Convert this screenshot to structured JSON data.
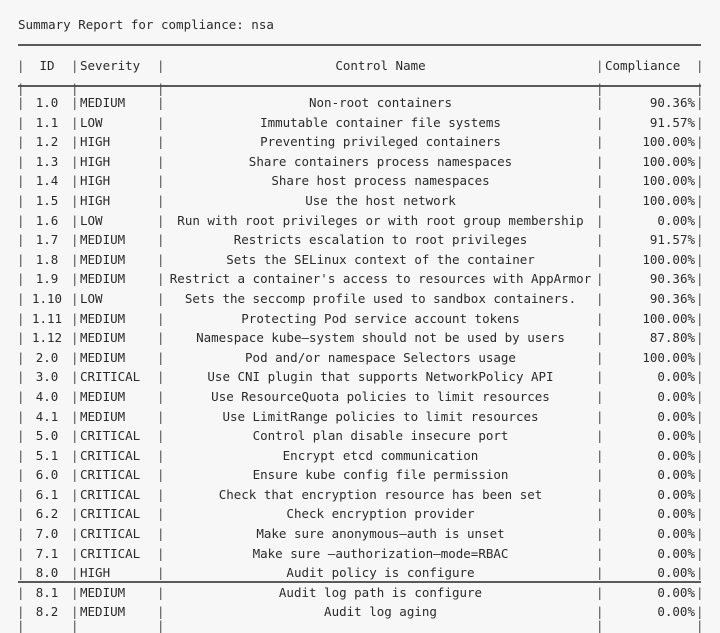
{
  "report": {
    "title": "Summary Report for compliance: nsa"
  },
  "table": {
    "columns": [
      {
        "key": "id",
        "label": "ID"
      },
      {
        "key": "severity",
        "label": "Severity"
      },
      {
        "key": "name",
        "label": "Control Name"
      },
      {
        "key": "compliance",
        "label": "Compliance"
      }
    ],
    "rows": [
      {
        "id": "1.0",
        "severity": "MEDIUM",
        "name": "Non-root containers",
        "compliance": "90.36%"
      },
      {
        "id": "1.1",
        "severity": "LOW",
        "name": "Immutable container file systems",
        "compliance": "91.57%"
      },
      {
        "id": "1.2",
        "severity": "HIGH",
        "name": "Preventing privileged containers",
        "compliance": "100.00%"
      },
      {
        "id": "1.3",
        "severity": "HIGH",
        "name": "Share containers process namespaces",
        "compliance": "100.00%"
      },
      {
        "id": "1.4",
        "severity": "HIGH",
        "name": "Share host process namespaces",
        "compliance": "100.00%"
      },
      {
        "id": "1.5",
        "severity": "HIGH",
        "name": "Use the host network",
        "compliance": "100.00%"
      },
      {
        "id": "1.6",
        "severity": "LOW",
        "name": "Run with root privileges or with root group membership",
        "compliance": "0.00%"
      },
      {
        "id": "1.7",
        "severity": "MEDIUM",
        "name": "Restricts escalation to root privileges",
        "compliance": "91.57%"
      },
      {
        "id": "1.8",
        "severity": "MEDIUM",
        "name": "Sets the SELinux context of the container",
        "compliance": "100.00%"
      },
      {
        "id": "1.9",
        "severity": "MEDIUM",
        "name": "Restrict a container's access to resources with AppArmor",
        "compliance": "90.36%"
      },
      {
        "id": "1.10",
        "severity": "LOW",
        "name": "Sets the seccomp profile used to sandbox containers.",
        "compliance": "90.36%"
      },
      {
        "id": "1.11",
        "severity": "MEDIUM",
        "name": "Protecting Pod service account tokens",
        "compliance": "100.00%"
      },
      {
        "id": "1.12",
        "severity": "MEDIUM",
        "name": "Namespace kube–system should not be used by users",
        "compliance": "87.80%"
      },
      {
        "id": "2.0",
        "severity": "MEDIUM",
        "name": "Pod and/or namespace Selectors usage",
        "compliance": "100.00%"
      },
      {
        "id": "3.0",
        "severity": "CRITICAL",
        "name": "Use CNI plugin that supports NetworkPolicy API",
        "compliance": "0.00%"
      },
      {
        "id": "4.0",
        "severity": "MEDIUM",
        "name": "Use ResourceQuota policies to limit resources",
        "compliance": "0.00%"
      },
      {
        "id": "4.1",
        "severity": "MEDIUM",
        "name": "Use LimitRange policies to limit resources",
        "compliance": "0.00%"
      },
      {
        "id": "5.0",
        "severity": "CRITICAL",
        "name": "Control plan disable insecure port",
        "compliance": "0.00%"
      },
      {
        "id": "5.1",
        "severity": "CRITICAL",
        "name": "Encrypt etcd communication",
        "compliance": "0.00%"
      },
      {
        "id": "6.0",
        "severity": "CRITICAL",
        "name": "Ensure kube config file permission",
        "compliance": "0.00%"
      },
      {
        "id": "6.1",
        "severity": "CRITICAL",
        "name": "Check that encryption resource has been set",
        "compliance": "0.00%"
      },
      {
        "id": "6.2",
        "severity": "CRITICAL",
        "name": "Check encryption provider",
        "compliance": "0.00%"
      },
      {
        "id": "7.0",
        "severity": "CRITICAL",
        "name": "Make sure anonymous–auth is unset",
        "compliance": "0.00%"
      },
      {
        "id": "7.1",
        "severity": "CRITICAL",
        "name": "Make sure –authorization–mode=RBAC",
        "compliance": "0.00%"
      },
      {
        "id": "8.0",
        "severity": "HIGH",
        "name": "Audit policy is configure",
        "compliance": "0.00%"
      },
      {
        "id": "8.1",
        "severity": "MEDIUM",
        "name": "Audit log path is configure",
        "compliance": "0.00%"
      },
      {
        "id": "8.2",
        "severity": "MEDIUM",
        "name": "Audit log aging",
        "compliance": "0.00%"
      }
    ]
  },
  "theme": {
    "background": "#f7f7f7",
    "text": "#2b2b2b",
    "rule": "#5a5a5a"
  }
}
